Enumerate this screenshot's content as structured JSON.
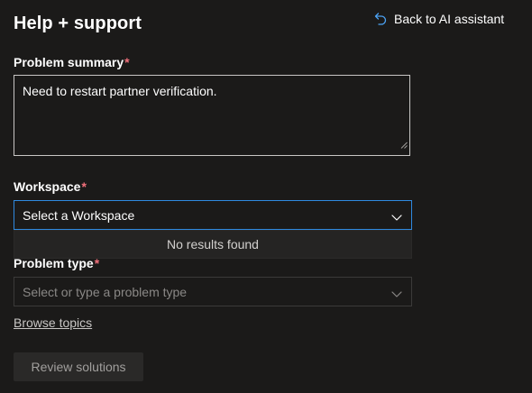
{
  "header": {
    "title": "Help + support",
    "back_link_label": "Back to AI assistant"
  },
  "form": {
    "problem_summary": {
      "label": "Problem summary",
      "required_mark": "*",
      "value": "Need to restart partner verification."
    },
    "workspace": {
      "label": "Workspace",
      "required_mark": "*",
      "placeholder": "Select a Workspace",
      "dropdown_message": "No results found",
      "focused_border_color": "#2f8ae0"
    },
    "problem_type": {
      "label": "Problem type",
      "required_mark": "*",
      "placeholder": "Select or type a problem type"
    },
    "browse_topics_label": "Browse topics",
    "review_button_label": "Review solutions"
  },
  "colors": {
    "background": "#1b1a19",
    "required": "#f1707b",
    "accent": "#2f8ae0"
  },
  "icons": {
    "back": "undo-arrow-icon",
    "chevron": "chevron-down-icon"
  }
}
